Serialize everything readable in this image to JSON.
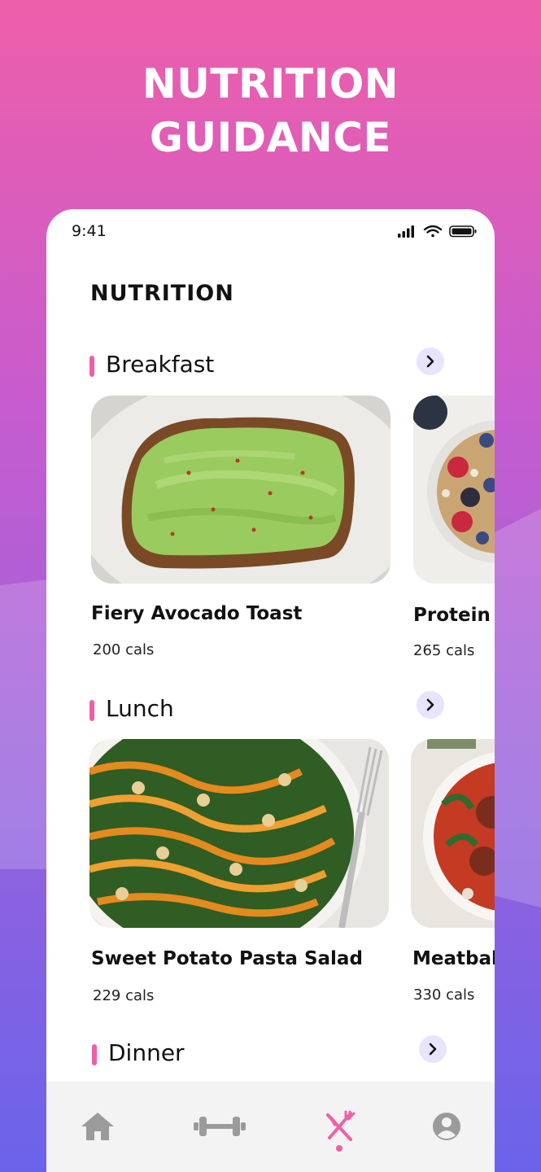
{
  "headline": {
    "line1": "NUTRITION",
    "line2": "GUIDANCE"
  },
  "status_bar": {
    "time": "9:41"
  },
  "page_title": "NUTRITION",
  "sections": [
    {
      "title": "Breakfast",
      "items": [
        {
          "name": "Fiery Avocado Toast",
          "cals": "200 cals"
        },
        {
          "name": "Protein I",
          "cals": "265 cals"
        }
      ]
    },
    {
      "title": "Lunch",
      "items": [
        {
          "name": "Sweet Potato Pasta Salad",
          "cals": "229 cals"
        },
        {
          "name": "Meatbal",
          "cals": "330 cals"
        }
      ]
    },
    {
      "title": "Dinner",
      "items": []
    }
  ],
  "tab_bar": {
    "tabs": [
      {
        "icon": "home-icon",
        "active": false
      },
      {
        "icon": "dumbbell-icon",
        "active": false
      },
      {
        "icon": "fork-knife-icon",
        "active": true
      },
      {
        "icon": "profile-icon",
        "active": false
      }
    ]
  },
  "colors": {
    "accent": "#ef5fa6",
    "arrow_bg": "#e7e4fb",
    "inactive_icon": "#9b9b9b",
    "gradient_top": "#ee5ea9",
    "gradient_bottom": "#6a63ea"
  }
}
